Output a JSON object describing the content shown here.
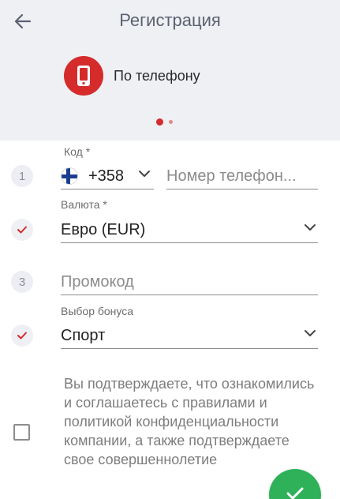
{
  "header": {
    "title": "Регистрация",
    "method_label": "По телефону"
  },
  "steps": {
    "step1": "1",
    "step3": "3"
  },
  "phone": {
    "code_label": "Код *",
    "code_value": "+358",
    "country_flag": "finland-flag-icon",
    "placeholder": "Номер телефон..."
  },
  "currency": {
    "label": "Валюта *",
    "value": "Евро (EUR)"
  },
  "promo": {
    "placeholder": "Промокод"
  },
  "bonus": {
    "label": "Выбор бонуса",
    "value": "Спорт"
  },
  "terms": {
    "text": "Вы подтверждаете, что ознакомились и соглашаетесь с правилами и политикой конфиденциальности компании, а также подтверждаете свое совершеннолетие"
  },
  "colors": {
    "accent": "#d52b2b",
    "confirm": "#2fb15a",
    "header_bg": "#eef0f4"
  },
  "icons": {
    "back": "arrow-left-icon",
    "method": "phone-icon",
    "check": "check-icon",
    "dropdown": "chevron-down-icon",
    "submit": "check-icon"
  }
}
